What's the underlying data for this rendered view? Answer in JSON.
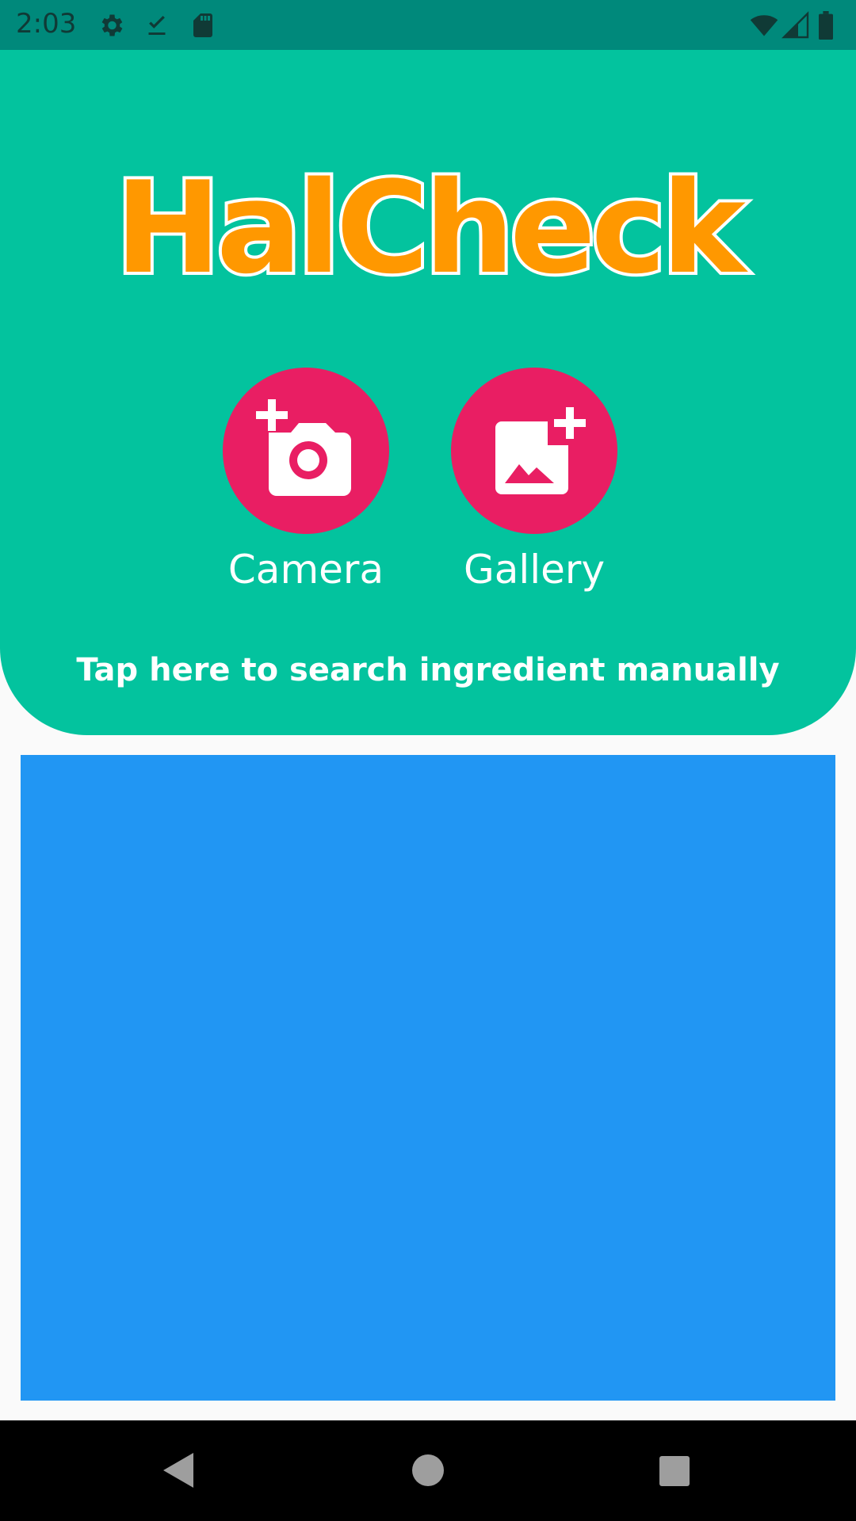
{
  "status_bar": {
    "time": "2:03",
    "left_icons": [
      "gear-icon",
      "download-done-icon",
      "sd-card-icon"
    ],
    "right_icons": [
      "wifi-icon",
      "cell-signal-icon",
      "battery-icon"
    ]
  },
  "header": {
    "app_title": "HalCheck",
    "background_color": "#03c39e",
    "title_color": "#ff9800",
    "actions": [
      {
        "label": "Camera",
        "icon": "add-camera-icon"
      },
      {
        "label": "Gallery",
        "icon": "add-photo-icon"
      }
    ],
    "action_color": "#e91e63",
    "manual_search_label": "Tap here to search ingredient manually"
  },
  "content": {
    "color": "#2196f3"
  },
  "nav_bar": {
    "buttons": [
      "back-icon",
      "home-icon",
      "recents-icon"
    ]
  }
}
